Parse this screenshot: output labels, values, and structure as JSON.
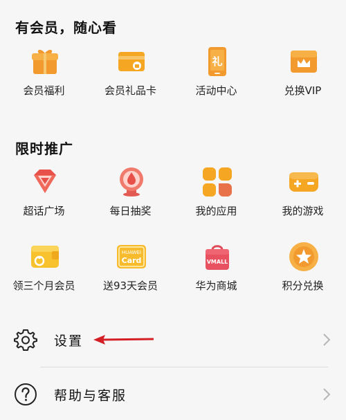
{
  "membership": {
    "title": "有会员，随心看",
    "items": [
      {
        "label": "会员福利",
        "icon": "gift-icon"
      },
      {
        "label": "会员礼品卡",
        "icon": "gift-card-icon"
      },
      {
        "label": "活动中心",
        "icon": "event-center-icon"
      },
      {
        "label": "兑换VIP",
        "icon": "crown-icon"
      }
    ]
  },
  "promotion": {
    "title": "限时推广",
    "items": [
      {
        "label": "超话广场",
        "icon": "diamond-icon"
      },
      {
        "label": "每日抽奖",
        "icon": "lottery-icon"
      },
      {
        "label": "我的应用",
        "icon": "apps-icon"
      },
      {
        "label": "我的游戏",
        "icon": "gamepad-icon"
      },
      {
        "label": "领三个月会员",
        "icon": "wallet-icon"
      },
      {
        "label": "送93天会员",
        "icon": "huawei-card-icon",
        "card_top": "HUAWEI",
        "card_bottom": "Card"
      },
      {
        "label": "华为商城",
        "icon": "vmall-bag-icon",
        "bag_text": "VMALL"
      },
      {
        "label": "积分兑换",
        "icon": "star-coin-icon"
      }
    ]
  },
  "settings": {
    "items": [
      {
        "label": "设置",
        "icon": "gear-icon"
      },
      {
        "label": "帮助与客服",
        "icon": "help-icon"
      }
    ]
  },
  "colors": {
    "accent_orange": "#f5a623",
    "accent_red": "#e8514a",
    "arrow_red": "#d31e25"
  }
}
